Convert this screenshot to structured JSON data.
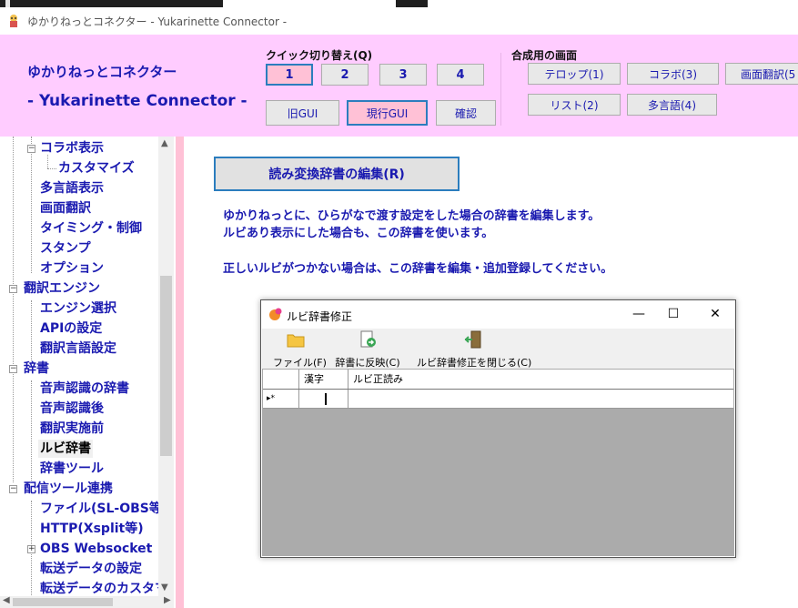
{
  "window": {
    "title": "ゆかりねっとコネクター  - Yukarinette Connector -"
  },
  "header": {
    "app_name_line1": "ゆかりねっとコネクター",
    "app_name_line2": "- Yukarinette Connector -",
    "quick_switch_label": "クイック切り替え(Q)",
    "quick_buttons": [
      "1",
      "2",
      "3",
      "4"
    ],
    "quick_selected": "1",
    "gui_buttons": {
      "old": "旧GUI",
      "current": "現行GUI",
      "confirm": "確認"
    },
    "composite_label": "合成用の画面",
    "composite_buttons": [
      "テロップ(1)",
      "コラボ(3)",
      "画面翻訳(5",
      "リスト(2)",
      "多言語(4)"
    ]
  },
  "sidebar": {
    "items": [
      {
        "label": "コラボ表示",
        "level": 1
      },
      {
        "label": "カスタマイズ",
        "level": 2
      },
      {
        "label": "多言語表示",
        "level": 1
      },
      {
        "label": "画面翻訳",
        "level": 1
      },
      {
        "label": "タイミング・制御",
        "level": 1
      },
      {
        "label": "スタンプ",
        "level": 1
      },
      {
        "label": "オプション",
        "level": 1
      },
      {
        "label": "翻訳エンジン",
        "level": 0
      },
      {
        "label": "エンジン選択",
        "level": 1
      },
      {
        "label": "APIの設定",
        "level": 1
      },
      {
        "label": "翻訳言語設定",
        "level": 1
      },
      {
        "label": "辞書",
        "level": 0
      },
      {
        "label": "音声認識の辞書",
        "level": 1
      },
      {
        "label": "音声認識後",
        "level": 1
      },
      {
        "label": "翻訳実施前",
        "level": 1
      },
      {
        "label": "ルビ辞書",
        "level": 1,
        "selected": true
      },
      {
        "label": "辞書ツール",
        "level": 1
      },
      {
        "label": "配信ツール連携",
        "level": 0
      },
      {
        "label": "ファイル(SL-OBS等)",
        "level": 1
      },
      {
        "label": "HTTP(Xsplit等)",
        "level": 1
      },
      {
        "label": "OBS Websocket",
        "level": 1
      },
      {
        "label": "転送データの設定",
        "level": 1
      },
      {
        "label": "転送データのカスタマ",
        "level": 1
      }
    ]
  },
  "main": {
    "edit_button": "読み変換辞書の編集(R)",
    "desc_line1": "ゆかりねっとに、ひらがなで渡す設定をした場合の辞書を編集します。",
    "desc_line2": "ルビあり表示にした場合も、この辞書を使います。",
    "desc_line3": "正しいルビがつかない場合は、この辞書を編集・追加登録してください。"
  },
  "dialog": {
    "title": "ルビ辞書修正",
    "toolbar": {
      "file": "ファイル(F)",
      "apply": "辞書に反映(C)",
      "close": "ルビ辞書修正を閉じる(C)"
    },
    "grid": {
      "columns": [
        "漢字",
        "ルビ正読み"
      ],
      "new_row_marker": "▸*"
    }
  },
  "colors": {
    "header_bg": "#ffccff",
    "accent_text": "#1a1ab0",
    "active_button_bg": "#ffc1d6",
    "focus_border": "#2b7dbe"
  }
}
